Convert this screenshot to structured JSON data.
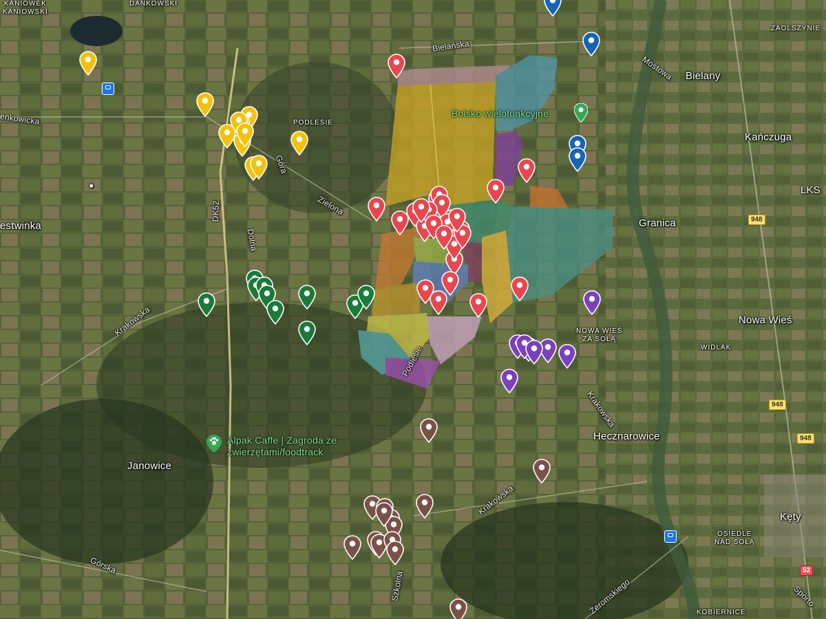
{
  "map": {
    "labels": {
      "kaniowek": "KANIÓWEK\nKANIOWSKI",
      "dankowski": "DANKOWSKI",
      "zaolszynie": "ZAOLSZYNIE",
      "bielany": "Bielany",
      "kanczuga": "Kańczuga",
      "lks": "LKS",
      "granica": "Granica",
      "podlesie": "PODLESIE",
      "pestwinka": "estwinka",
      "nowa_wies": "Nowa Wieś",
      "nowa_wies_za_sola": "NOWA WIEŚ\nZA SOŁĄ",
      "widlak": "WIDLAK",
      "hecznarowice": "Hecznarowice",
      "janowice": "Janowice",
      "kety": "Kęty",
      "osiedle": "OSIEDLE\nNAD SOŁĄ",
      "kobiernice": "KOBIERNICE",
      "boisko": "Boisko wielofunkcyjne",
      "alpak": "Alpak Caffe | Zagroda ze\nzwierzętami/foodtrack"
    },
    "streets": {
      "bielanska": "Bielańska",
      "mostowa": "Mostowa",
      "enkowicka": "enkowicka",
      "dk52": "DK52",
      "gora": "Góra",
      "zielona": "Zielona",
      "dolna": "Dolna",
      "krakowska1": "Krakowska",
      "krakowska2": "Krakowska",
      "krakowska3": "Krakowska",
      "podlesie_ul": "Podleśie",
      "gorska": "Górska",
      "szkolna": "Szkolna",
      "zeromskiego": "Żeromskiego",
      "sportowa": "Sporto"
    },
    "road_shields": {
      "s948a": "948",
      "s948b": "948",
      "s948c": "948",
      "s52": "52"
    },
    "colors": {
      "red": "#e9464f",
      "yellow": "#f4c20d",
      "green": "#1b7a3a",
      "blue": "#1565b4",
      "purple": "#7b3fbf",
      "brown": "#7a5148",
      "poi_green": "#34a853"
    },
    "marker_groups": [
      {
        "color": "yellow",
        "icon": "map-pin-icon",
        "count": 11
      },
      {
        "color": "red",
        "icon": "map-pin-icon",
        "count": 29
      },
      {
        "color": "green",
        "icon": "map-pin-icon",
        "count": 10
      },
      {
        "color": "blue",
        "icon": "map-pin-icon",
        "count": 4
      },
      {
        "color": "purple",
        "icon": "map-pin-icon",
        "count": 8
      },
      {
        "color": "brown",
        "icon": "map-pin-icon",
        "count": 14
      }
    ]
  }
}
